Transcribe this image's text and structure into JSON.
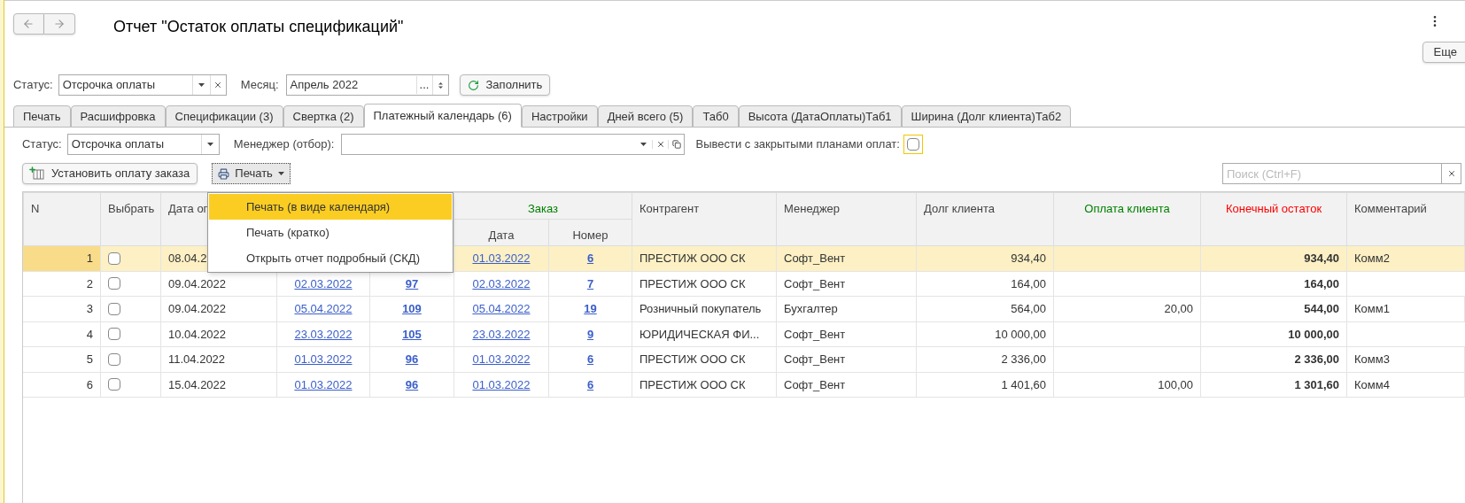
{
  "window": {
    "title": "Отчет \"Остаток оплаты спецификаций\"",
    "more_button": "Еще"
  },
  "top_filters": {
    "status": {
      "label": "Статус:",
      "value": "Отсрочка оплаты"
    },
    "month": {
      "label": "Месяц:",
      "value": "Апрель 2022",
      "picker": "..."
    },
    "fill_button": "Заполнить"
  },
  "tabs": [
    {
      "label": "Печать",
      "selected": false
    },
    {
      "label": "Расшифровка",
      "selected": false
    },
    {
      "label": "Спецификации (3)",
      "selected": false
    },
    {
      "label": "Свертка (2)",
      "selected": false
    },
    {
      "label": "Платежный календарь (6)",
      "selected": true
    },
    {
      "label": "Настройки",
      "selected": false
    },
    {
      "label": "Дней всего (5)",
      "selected": false
    },
    {
      "label": "Таб0",
      "selected": false
    },
    {
      "label": "Высота (ДатаОплаты)Таб1",
      "selected": false
    },
    {
      "label": "Ширина (Долг клиента)Таб2",
      "selected": false
    }
  ],
  "sub_filters": {
    "status": {
      "label": "Статус:",
      "value": "Отсрочка оплаты"
    },
    "manager": {
      "label": "Менеджер (отбор):"
    },
    "closed_plans": {
      "label": "Вывести с закрытыми планами оплат:",
      "checked": false
    }
  },
  "toolbar": {
    "set_payment_button": "Установить оплату заказа",
    "print_button": "Печать",
    "search": {
      "placeholder": "Поиск (Ctrl+F)"
    }
  },
  "print_menu": [
    {
      "label": "Печать (в виде календаря)",
      "selected": true
    },
    {
      "label": "Печать (кратко)",
      "selected": false
    },
    {
      "label": "Открыть отчет подробный (СКД)",
      "selected": false
    }
  ],
  "table": {
    "columns": {
      "n": "N",
      "choose": "Выбрать",
      "pay_date": "Дата оп",
      "order_group": {
        "label": "Заказ",
        "color": "#008000"
      },
      "order_date": "Дата",
      "order_number": "Номер",
      "counterparty": "Контрагент",
      "manager": "Менеджер",
      "debt": "Долг клиента",
      "payment": {
        "label": "Оплата клиента",
        "color": "#008000"
      },
      "balance": {
        "label": "Конечный остаток",
        "color": "#ff0000"
      },
      "comment": "Комментарий"
    },
    "rows": [
      {
        "n": "1",
        "checked": false,
        "selected": true,
        "pay_date": "08.04.2",
        "order_date": "01.03.2022",
        "order_number": "6",
        "counterparty": "ПРЕСТИЖ ООО СК",
        "manager": "Софт_Вент",
        "debt": "934,40",
        "balance": "934,40",
        "comment": "Комм2"
      },
      {
        "n": "2",
        "checked": false,
        "selected": false,
        "pay_date": "09.04.2022",
        "spec_date": "02.03.2022",
        "spec_number": "97",
        "order_date": "02.03.2022",
        "order_number": "7",
        "counterparty": "ПРЕСТИЖ ООО СК",
        "manager": "Софт_Вент",
        "debt": "164,00",
        "balance": "164,00"
      },
      {
        "n": "3",
        "checked": false,
        "selected": false,
        "pay_date": "09.04.2022",
        "spec_date": "05.04.2022",
        "spec_number": "109",
        "order_date": "05.04.2022",
        "order_number": "19",
        "counterparty": "Розничный покупатель",
        "manager": "Бухгалтер",
        "debt": "564,00",
        "payment": "20,00",
        "balance": "544,00",
        "comment": "Комм1"
      },
      {
        "n": "4",
        "checked": false,
        "selected": false,
        "pay_date": "10.04.2022",
        "spec_date": "23.03.2022",
        "spec_number": "105",
        "order_date": "23.03.2022",
        "order_number": "9",
        "counterparty": "ЮРИДИЧЕСКАЯ ФИ...",
        "manager": "Софт_Вент",
        "debt": "10 000,00",
        "balance": "10 000,00"
      },
      {
        "n": "5",
        "checked": false,
        "selected": false,
        "pay_date": "11.04.2022",
        "spec_date": "01.03.2022",
        "spec_number": "96",
        "order_date": "01.03.2022",
        "order_number": "6",
        "counterparty": "ПРЕСТИЖ ООО СК",
        "manager": "Софт_Вент",
        "debt": "2 336,00",
        "balance": "2 336,00",
        "comment": "Комм3"
      },
      {
        "n": "6",
        "checked": false,
        "selected": false,
        "pay_date": "15.04.2022",
        "spec_date": "01.03.2022",
        "spec_number": "96",
        "order_date": "01.03.2022",
        "order_number": "6",
        "counterparty": "ПРЕСТИЖ ООО СК",
        "manager": "Софт_Вент",
        "debt": "1 401,60",
        "payment": "100,00",
        "balance": "1 301,60",
        "comment": "Комм4"
      }
    ]
  }
}
